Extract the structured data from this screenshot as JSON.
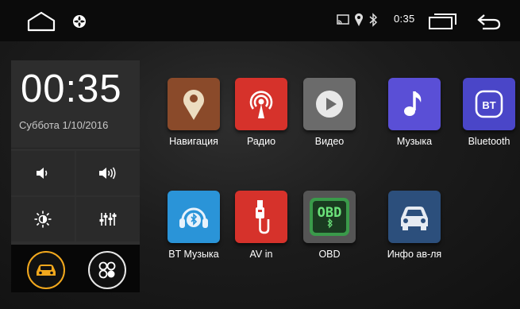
{
  "status_bar": {
    "time": "0:35",
    "icons": [
      "home-icon",
      "fan-icon",
      "cast-icon",
      "location-icon",
      "bluetooth-icon",
      "recents-icon",
      "back-icon"
    ]
  },
  "clock": {
    "time": "00:35",
    "date": "Суббота 1/10/2016"
  },
  "controls": [
    "volume-down-icon",
    "volume-up-icon",
    "brightness-icon",
    "equalizer-icon"
  ],
  "bottom_buttons": [
    "car-icon",
    "apps-icon"
  ],
  "apps": [
    {
      "label": "Навигация",
      "icon": "navigation-icon",
      "color": "#8a4a2a"
    },
    {
      "label": "Радио",
      "icon": "radio-icon",
      "color": "#d6322b"
    },
    {
      "label": "Видео",
      "icon": "video-icon",
      "color": "#6b6b6b"
    },
    {
      "label": "Музыка",
      "icon": "music-icon",
      "color": "#5a4fd6"
    },
    {
      "label": "Bluetooth",
      "icon": "bluetooth-app-icon",
      "color": "#4a46c8"
    },
    {
      "label": "BT Музыка",
      "icon": "bt-music-icon",
      "color": "#2a94d8"
    },
    {
      "label": "AV in",
      "icon": "av-in-icon",
      "color": "#d6322b"
    },
    {
      "label": "OBD",
      "icon": "obd-icon",
      "color": "#3a9a4a"
    },
    {
      "label": "Инфо ав-ля",
      "icon": "car-info-icon",
      "color": "#2c4f7c"
    }
  ]
}
